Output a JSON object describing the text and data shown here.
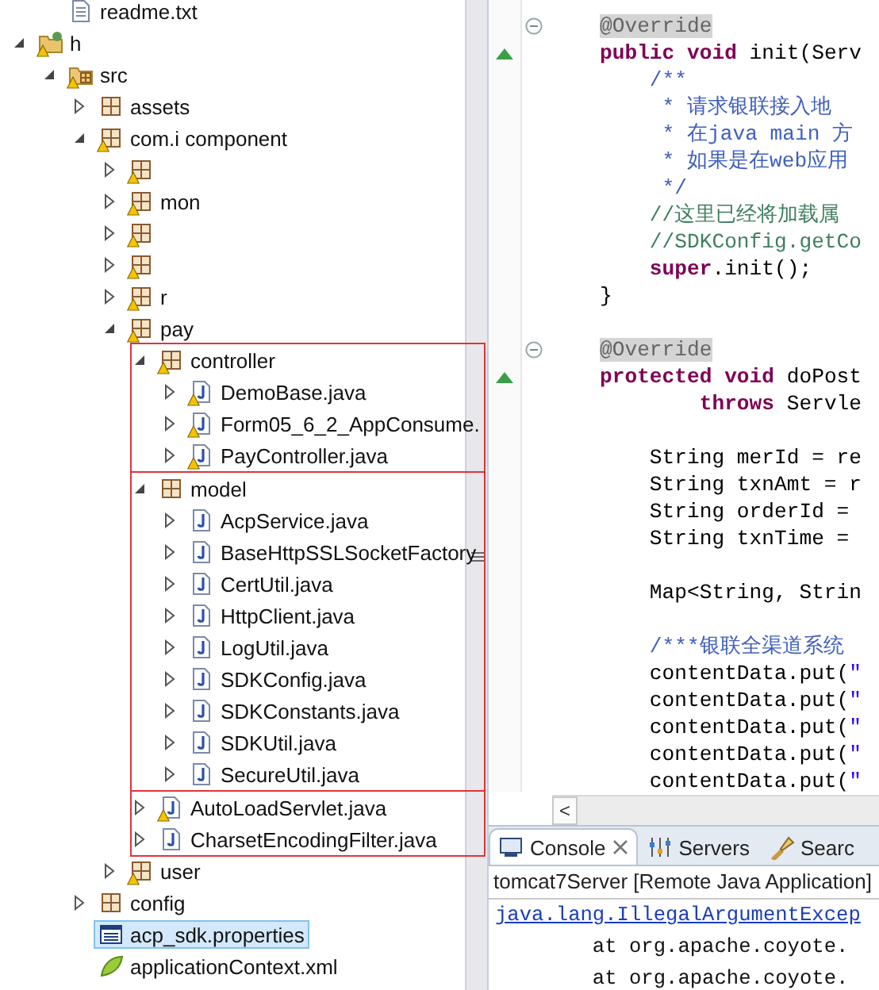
{
  "tree": {
    "continued_items": [
      {
        "label": "readme.txt",
        "kind": "text",
        "warning": false,
        "selected": false
      }
    ],
    "items": [
      {
        "label": "h",
        "kind": "project",
        "warning": true,
        "selected": false,
        "expanded": true,
        "children": [
          {
            "label": "src",
            "kind": "folder",
            "warning": true,
            "selected": false,
            "expanded": true,
            "children": [
              {
                "label": "assets",
                "kind": "package",
                "warning": false,
                "selected": false,
                "expanded": false
              },
              {
                "label": "com.i     component",
                "kind": "package",
                "warning": true,
                "selected": false,
                "expanded": true,
                "children": [
                  {
                    "kind": "package",
                    "warning": true,
                    "selected": false,
                    "expanded": false
                  },
                  {
                    "label": "mon",
                    "kind": "package",
                    "warning": true,
                    "selected": false,
                    "expanded": false
                  },
                  {
                    "kind": "package",
                    "warning": true,
                    "selected": false,
                    "expanded": false
                  },
                  {
                    "kind": "package",
                    "warning": true,
                    "selected": false,
                    "expanded": false
                  },
                  {
                    "label": "r",
                    "kind": "package",
                    "warning": true,
                    "selected": false,
                    "expanded": false
                  },
                  {
                    "label": "pay",
                    "kind": "package",
                    "warning": true,
                    "selected": false,
                    "expanded": true,
                    "children": [
                      {
                        "label": "controller",
                        "kind": "package",
                        "warning": true,
                        "selected": false,
                        "expanded": true,
                        "framed": true,
                        "children": [
                          {
                            "label": "DemoBase.java",
                            "kind": "java",
                            "warning": true,
                            "selected": false,
                            "expanded": false
                          },
                          {
                            "label": "Form05_6_2_AppConsume.",
                            "kind": "java",
                            "warning": true,
                            "selected": false,
                            "expanded": false
                          },
                          {
                            "label": "PayController.java",
                            "kind": "java",
                            "warning": true,
                            "selected": false,
                            "expanded": false
                          }
                        ]
                      },
                      {
                        "label": "model",
                        "kind": "package",
                        "warning": false,
                        "selected": false,
                        "expanded": true,
                        "framed": true,
                        "children": [
                          {
                            "label": "AcpService.java",
                            "kind": "java",
                            "warning": false,
                            "selected": false,
                            "expanded": false
                          },
                          {
                            "label": "BaseHttpSSLSocketFactory",
                            "kind": "java",
                            "warning": false,
                            "selected": false,
                            "expanded": false
                          },
                          {
                            "label": "CertUtil.java",
                            "kind": "java",
                            "warning": false,
                            "selected": false,
                            "expanded": false
                          },
                          {
                            "label": "HttpClient.java",
                            "kind": "java",
                            "warning": false,
                            "selected": false,
                            "expanded": false
                          },
                          {
                            "label": "LogUtil.java",
                            "kind": "java",
                            "warning": false,
                            "selected": false,
                            "expanded": false
                          },
                          {
                            "label": "SDKConfig.java",
                            "kind": "java",
                            "warning": false,
                            "selected": false,
                            "expanded": false
                          },
                          {
                            "label": "SDKConstants.java",
                            "kind": "java",
                            "warning": false,
                            "selected": false,
                            "expanded": false
                          },
                          {
                            "label": "SDKUtil.java",
                            "kind": "java",
                            "warning": false,
                            "selected": false,
                            "expanded": false
                          },
                          {
                            "label": "SecureUtil.java",
                            "kind": "java",
                            "warning": false,
                            "selected": false,
                            "expanded": false
                          }
                        ]
                      },
                      {
                        "label": "AutoLoadServlet.java",
                        "kind": "java",
                        "warning": true,
                        "selected": false,
                        "expanded": false,
                        "framed": true
                      },
                      {
                        "label": "CharsetEncodingFilter.java",
                        "kind": "java",
                        "warning": false,
                        "selected": false,
                        "expanded": false,
                        "framed": true
                      }
                    ]
                  },
                  {
                    "label": "user",
                    "kind": "package",
                    "warning": true,
                    "selected": false,
                    "expanded": false
                  }
                ]
              },
              {
                "label": "config",
                "kind": "package",
                "warning": false,
                "selected": false,
                "expanded": false
              },
              {
                "label": "acp_sdk.properties",
                "kind": "properties",
                "warning": false,
                "selected": true
              },
              {
                "label": "applicationContext.xml",
                "kind": "xml",
                "warning": false,
                "selected": false
              }
            ]
          }
        ]
      }
    ]
  },
  "editor": {
    "lines": [
      {
        "kind": "code",
        "folded": false,
        "override": false,
        "segments": [
          {
            "text": "@Override",
            "kind": "annotation"
          }
        ]
      },
      {
        "kind": "code",
        "override": true,
        "segments": [
          {
            "text": "public void",
            "kind": "keyword"
          },
          {
            "text": " init(Serv",
            "kind": "plain"
          }
        ]
      },
      {
        "kind": "code",
        "override": false,
        "segments": [
          {
            "text": "    /**",
            "kind": "javadoc"
          }
        ]
      },
      {
        "kind": "code",
        "override": false,
        "segments": [
          {
            "text": "     * 请求银联接入地",
            "kind": "javadoc"
          }
        ]
      },
      {
        "kind": "code",
        "override": false,
        "segments": [
          {
            "text": "     * 在java main 方",
            "kind": "javadoc"
          }
        ]
      },
      {
        "kind": "code",
        "override": false,
        "segments": [
          {
            "text": "     * 如果是在web应用",
            "kind": "javadoc"
          }
        ]
      },
      {
        "kind": "code",
        "override": false,
        "segments": [
          {
            "text": "     */",
            "kind": "javadoc"
          }
        ]
      },
      {
        "kind": "code",
        "override": false,
        "segments": [
          {
            "text": "    //这里已经将加载属",
            "kind": "comment"
          }
        ]
      },
      {
        "kind": "code",
        "override": false,
        "segments": [
          {
            "text": "    //SDKConfig.getCo",
            "kind": "comment"
          }
        ]
      },
      {
        "kind": "code",
        "override": false,
        "segments": [
          {
            "text": "    super",
            "kind": "keyword"
          },
          {
            "text": ".init();",
            "kind": "plain"
          }
        ]
      },
      {
        "kind": "code",
        "override": false,
        "segments": [
          {
            "text": "}",
            "kind": "plain"
          }
        ]
      },
      {
        "kind": "blank"
      },
      {
        "kind": "code",
        "folded": false,
        "override": false,
        "segments": [
          {
            "text": "@Override",
            "kind": "annotation"
          }
        ]
      },
      {
        "kind": "code",
        "override": true,
        "segments": [
          {
            "text": "protected void",
            "kind": "keyword"
          },
          {
            "text": " doPost",
            "kind": "plain"
          }
        ]
      },
      {
        "kind": "code",
        "override": false,
        "segments": [
          {
            "text": "        throws",
            "kind": "keyword"
          },
          {
            "text": " Servle",
            "kind": "plain"
          }
        ]
      },
      {
        "kind": "blank"
      },
      {
        "kind": "code",
        "override": false,
        "segments": [
          {
            "text": "    String merId = re",
            "kind": "plain"
          }
        ]
      },
      {
        "kind": "code",
        "override": false,
        "segments": [
          {
            "text": "    String txnAmt = r",
            "kind": "plain"
          }
        ]
      },
      {
        "kind": "code",
        "override": false,
        "segments": [
          {
            "text": "    String orderId =",
            "kind": "plain"
          }
        ]
      },
      {
        "kind": "code",
        "override": false,
        "segments": [
          {
            "text": "    String txnTime =",
            "kind": "plain"
          }
        ]
      },
      {
        "kind": "blank"
      },
      {
        "kind": "code",
        "override": false,
        "segments": [
          {
            "text": "    Map<String, Strin",
            "kind": "plain"
          }
        ]
      },
      {
        "kind": "blank"
      },
      {
        "kind": "code",
        "override": false,
        "segments": [
          {
            "text": "    /***银联全渠道系统",
            "kind": "javadoc"
          }
        ]
      },
      {
        "kind": "code",
        "override": false,
        "segments": [
          {
            "text": "    contentData.put(",
            "kind": "plain"
          },
          {
            "text": "\"",
            "kind": "string"
          }
        ]
      },
      {
        "kind": "code",
        "override": false,
        "segments": [
          {
            "text": "    contentData.put(",
            "kind": "plain"
          },
          {
            "text": "\"",
            "kind": "string"
          }
        ]
      },
      {
        "kind": "code",
        "override": false,
        "segments": [
          {
            "text": "    contentData.put(",
            "kind": "plain"
          },
          {
            "text": "\"",
            "kind": "string"
          }
        ]
      },
      {
        "kind": "code",
        "override": false,
        "segments": [
          {
            "text": "    contentData.put(",
            "kind": "plain"
          },
          {
            "text": "\"",
            "kind": "string"
          }
        ]
      },
      {
        "kind": "code",
        "override": false,
        "segments": [
          {
            "text": "    contentData.put(",
            "kind": "plain"
          },
          {
            "text": "\"",
            "kind": "string"
          }
        ]
      }
    ],
    "scroll_left": "<"
  },
  "console": {
    "tabs": [
      {
        "label": "Console",
        "kind": "console",
        "selected": true
      },
      {
        "label": "Servers",
        "kind": "servers",
        "selected": false
      },
      {
        "label": "Searc",
        "kind": "search",
        "selected": false
      }
    ],
    "header": "tomcat7Server [Remote Java Application]",
    "lines": [
      {
        "text": "java.lang.IllegalArgumentExcep",
        "kind": "link"
      },
      {
        "text": "        at org.apache.coyote.",
        "kind": "plain"
      },
      {
        "text": "        at org.apache.coyote.",
        "kind": "plain"
      }
    ]
  }
}
